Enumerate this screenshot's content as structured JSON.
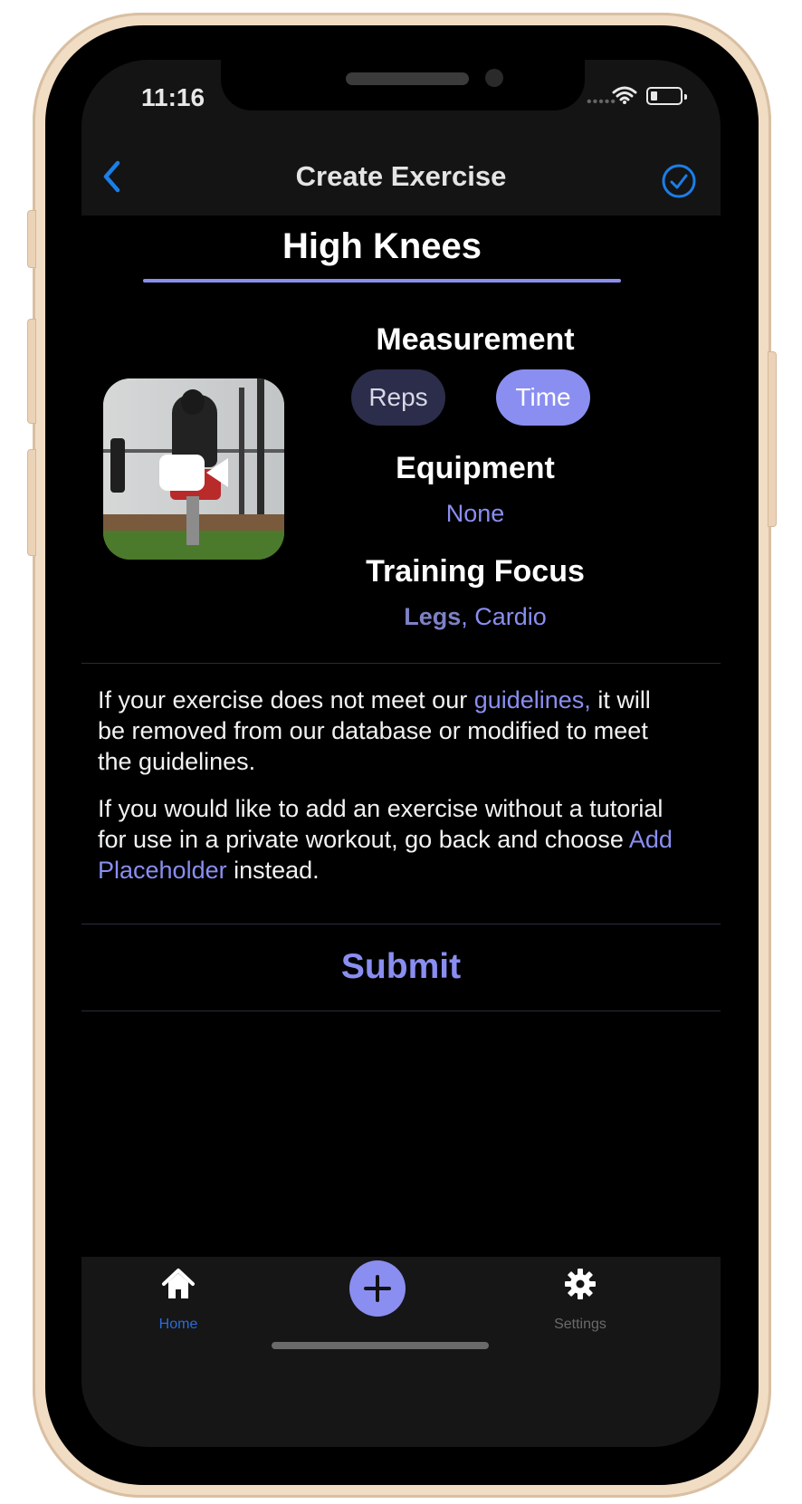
{
  "status_bar": {
    "time": "11:16"
  },
  "nav": {
    "title": "Create Exercise"
  },
  "exercise": {
    "name": "High Knees"
  },
  "measurement": {
    "heading": "Measurement",
    "options": [
      "Reps",
      "Time"
    ],
    "selected": "Time"
  },
  "equipment": {
    "heading": "Equipment",
    "value": "None"
  },
  "training_focus": {
    "heading": "Training Focus",
    "primary": "Legs",
    "separator": ", ",
    "secondary": "Cardio"
  },
  "info": {
    "p1_before": "If your exercise does not meet our ",
    "p1_link": "guidelines,",
    "p1_after": " it will be removed from our database or modified to meet the guidelines.",
    "p2_before": "If you would like to add an exercise without a tutorial for use in a private workout, go back and choose ",
    "p2_link": "Add Placeholder",
    "p2_after": " instead."
  },
  "submit_label": "Submit",
  "tabs": [
    {
      "label": "Home",
      "icon": "house-icon",
      "active": true
    },
    {
      "label": "",
      "icon": "plus-icon",
      "active": false
    },
    {
      "label": "Settings",
      "icon": "gear-icon",
      "active": false
    }
  ],
  "colors": {
    "accent": "#8a8ef0",
    "ios_blue": "#1a7fe8",
    "pill_inactive": "#2c2d4b",
    "frame": "#f1dcc4"
  }
}
